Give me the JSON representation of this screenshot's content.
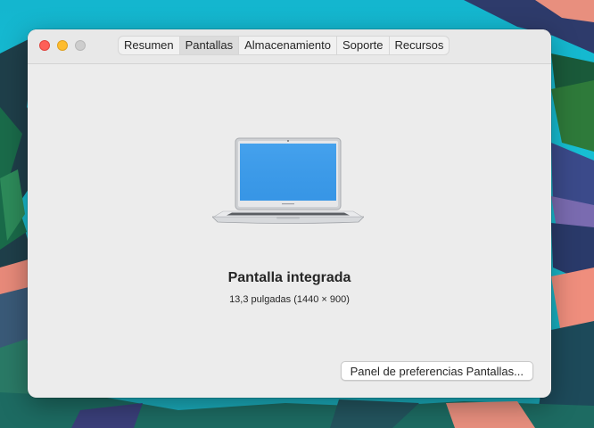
{
  "window": {
    "traffic_lights": [
      "close",
      "minimize",
      "zoom"
    ]
  },
  "tabs": [
    {
      "label": "Resumen",
      "active": false
    },
    {
      "label": "Pantallas",
      "active": true
    },
    {
      "label": "Almacenamiento",
      "active": false
    },
    {
      "label": "Soporte",
      "active": false
    },
    {
      "label": "Recursos",
      "active": false
    }
  ],
  "display": {
    "image_icon": "macbook-air-icon",
    "title": "Pantalla integrada",
    "subtitle": "13,3 pulgadas (1440 × 900)"
  },
  "footer": {
    "prefs_button_label": "Panel de preferencias Pantallas..."
  },
  "colors": {
    "close": "#fe5f57",
    "minimize": "#febc2e",
    "zoom_inactive": "#cdcdcd",
    "screen_blue": "#3d9be9",
    "wallpaper_teal": "#17bfd3"
  }
}
